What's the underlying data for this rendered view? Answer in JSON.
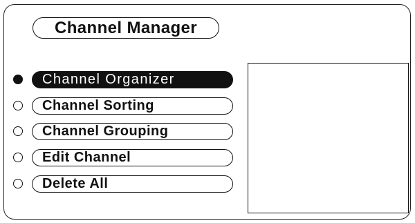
{
  "header": {
    "title": "Channel Manager"
  },
  "menu": {
    "items": [
      {
        "label": "Channel Organizer",
        "selected": true
      },
      {
        "label": "Channel Sorting",
        "selected": false
      },
      {
        "label": "Channel Grouping",
        "selected": false
      },
      {
        "label": "Edit Channel",
        "selected": false
      },
      {
        "label": "Delete All",
        "selected": false
      }
    ]
  },
  "colors": {
    "selected_bg": "#111111",
    "selected_text": "#ffffff",
    "border": "#111111"
  }
}
